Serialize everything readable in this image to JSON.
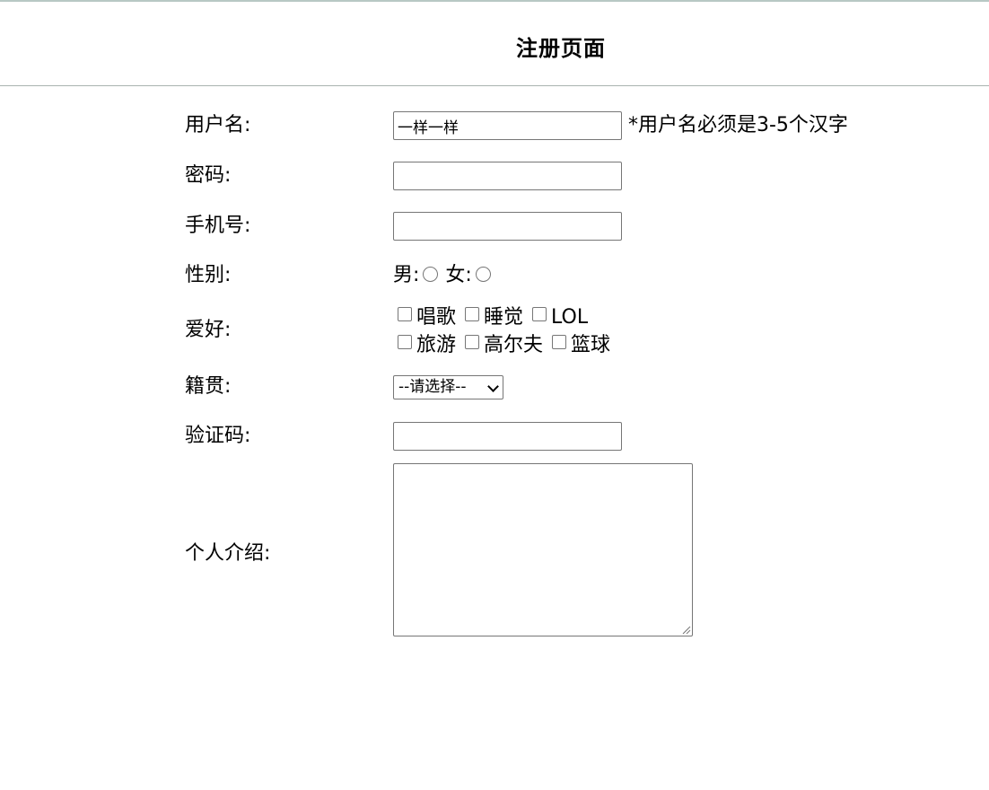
{
  "header": {
    "title": "注册页面"
  },
  "form": {
    "username": {
      "label": "用户名:",
      "value": "一样一样",
      "hint": "*用户名必须是3-5个汉字"
    },
    "password": {
      "label": "密码:",
      "value": ""
    },
    "phone": {
      "label": "手机号:",
      "value": ""
    },
    "gender": {
      "label": "性别:",
      "options": [
        "男:",
        "女:"
      ]
    },
    "hobby": {
      "label": "爱好:",
      "options": [
        "唱歌",
        "睡觉",
        "LOL",
        "旅游",
        "高尔夫",
        "篮球"
      ]
    },
    "hometown": {
      "label": "籍贯:",
      "selected": "--请选择--"
    },
    "captcha": {
      "label": "验证码:",
      "value": ""
    },
    "intro": {
      "label": "个人介绍:",
      "value": ""
    }
  }
}
